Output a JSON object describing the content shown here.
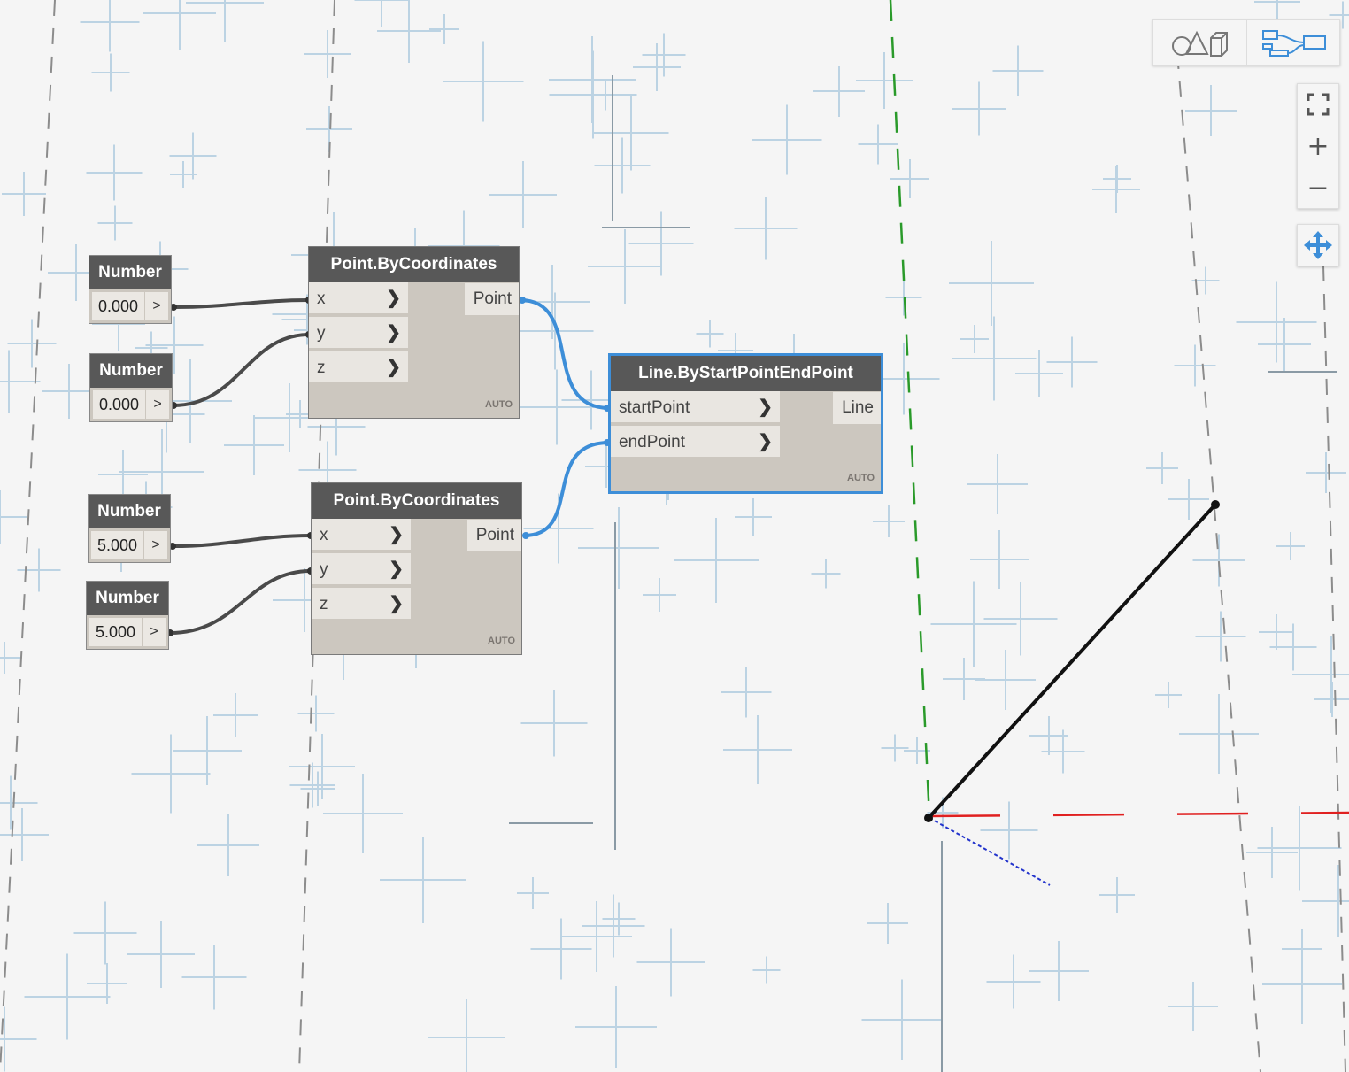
{
  "graph": {
    "number_nodes": [
      {
        "title": "Number",
        "value": "0.000",
        "arrow": ">"
      },
      {
        "title": "Number",
        "value": "0.000",
        "arrow": ">"
      },
      {
        "title": "Number",
        "value": "5.000",
        "arrow": ">"
      },
      {
        "title": "Number",
        "value": "5.000",
        "arrow": ">"
      }
    ],
    "point_nodes": [
      {
        "title": "Point.ByCoordinates",
        "inputs": [
          "x",
          "y",
          "z"
        ],
        "output": "Point",
        "lacing": "AUTO"
      },
      {
        "title": "Point.ByCoordinates",
        "inputs": [
          "x",
          "y",
          "z"
        ],
        "output": "Point",
        "lacing": "AUTO"
      }
    ],
    "line_node": {
      "title": "Line.ByStartPointEndPoint",
      "inputs": [
        "startPoint",
        "endPoint"
      ],
      "output": "Line",
      "lacing": "AUTO",
      "selected": true
    }
  },
  "toolbar": {
    "geometry_view_icon": "background-3d-preview-icon",
    "graph_view_icon": "graph-view-icon"
  },
  "navigation": {
    "fit_icon": "zoom-to-fit-icon",
    "zoom_in": "+",
    "zoom_out": "−",
    "pan_icon": "pan-icon"
  },
  "colors": {
    "selection": "#3d8ed8",
    "wire_default": "#4a4a4a",
    "wire_selected": "#3d8ed8",
    "x_axis": "#e02020",
    "y_axis": "#2a9a2a",
    "z_axis": "#2233cc",
    "node_header": "#585858",
    "node_body": "#ccc7bf"
  }
}
